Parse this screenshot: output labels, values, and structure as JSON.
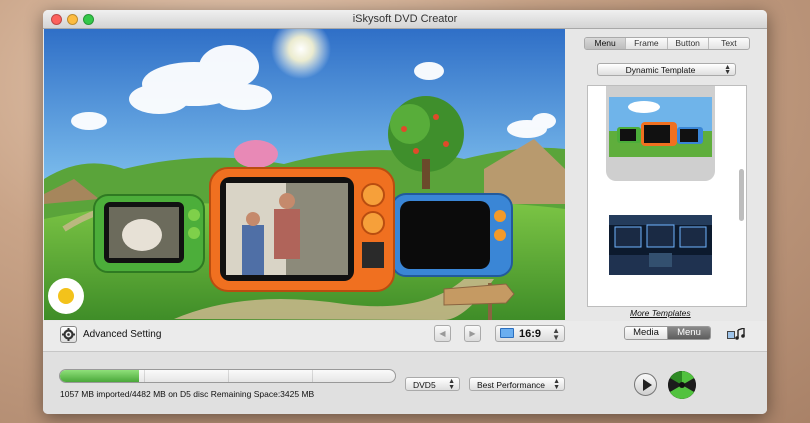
{
  "window": {
    "title": "iSkysoft DVD Creator"
  },
  "toolbar": {
    "advanced_setting": "Advanced Setting",
    "prev_icon": "prev-arrow-icon",
    "next_icon": "next-arrow-icon",
    "aspect_ratio": "16:9"
  },
  "status": {
    "progress_fraction": 0.236,
    "disc_info": "1057 MB imported/4482 MB on D5 disc   Remaining Space:3425 MB",
    "disc_type": "DVD5",
    "quality": "Best Performance"
  },
  "panel": {
    "tabs": [
      {
        "label": "Menu",
        "active": true
      },
      {
        "label": "Frame",
        "active": false
      },
      {
        "label": "Button",
        "active": false
      },
      {
        "label": "Text",
        "active": false
      }
    ],
    "template_select": "Dynamic Template",
    "more_templates": "More Templates",
    "modes": {
      "media": "Media",
      "menu": "Menu",
      "active": "Menu"
    }
  },
  "colors": {
    "progress_green": "#4aa83a",
    "menu_active": "#5d5d5d",
    "sky": "#5ea0e0",
    "grass": "#5fae3c",
    "tv_orange": "#f07020",
    "tv_green": "#4cae3a",
    "tv_blue": "#3a86d6"
  }
}
